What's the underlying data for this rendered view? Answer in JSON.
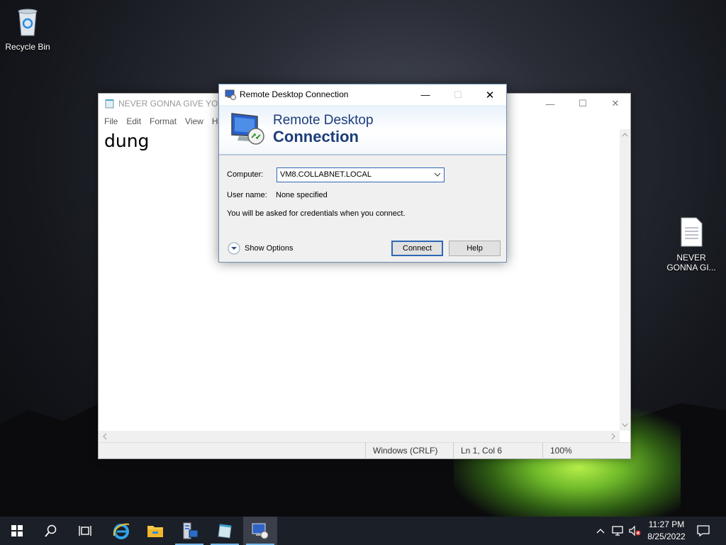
{
  "desktop": {
    "icons": [
      {
        "label": "Recycle Bin",
        "icon": "recycle-bin-icon"
      },
      {
        "label": "NEVER GONNA GI...",
        "icon": "text-document-icon"
      }
    ]
  },
  "notepad": {
    "title": "NEVER GONNA GIVE YOU I",
    "menu": [
      "File",
      "Edit",
      "Format",
      "View",
      "H"
    ],
    "content": "dung",
    "status": {
      "line_ending": "Windows (CRLF)",
      "position": "Ln 1, Col 6",
      "zoom": "100%"
    },
    "controls": {
      "minimize": "—",
      "maximize": "☐",
      "close": "✕"
    }
  },
  "rdc": {
    "window_title": "Remote Desktop Connection",
    "banner_line1": "Remote Desktop",
    "banner_line2": "Connection",
    "computer_label": "Computer:",
    "computer_value": "VM8.COLLABNET.LOCAL",
    "username_label": "User name:",
    "username_value": "None specified",
    "info_text": "You will be asked for credentials when you connect.",
    "show_options": "Show Options",
    "connect": "Connect",
    "help": "Help",
    "controls": {
      "minimize": "—",
      "maximize": "☐",
      "close": "✕"
    }
  },
  "taskbar": {
    "items": [
      "start-icon",
      "search-icon",
      "task-view-icon",
      "internet-explorer-icon",
      "file-explorer-icon",
      "server-manager-icon",
      "notepad-icon",
      "remote-desktop-icon"
    ],
    "time": "11:27 PM",
    "date": "8/25/2022"
  },
  "colors": {
    "accent": "#2e68b5",
    "banner_text": "#1c3d79",
    "taskbar": "#1b1f27"
  }
}
